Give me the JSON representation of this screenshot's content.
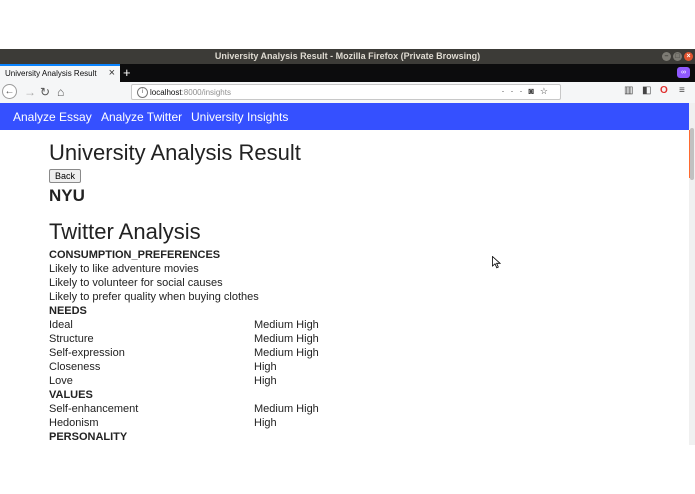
{
  "window": {
    "title": "University Analysis Result - Mozilla Firefox (Private Browsing)"
  },
  "tab": {
    "label": "University Analysis Result",
    "close": "×",
    "new_tab": "+"
  },
  "nav": {
    "url_host": "localhost",
    "url_path": ":8000/insights",
    "page_actions": "···"
  },
  "app_nav": {
    "items": [
      "Analyze Essay",
      "Analyze Twitter",
      "University Insights"
    ]
  },
  "page": {
    "heading": "University Analysis Result",
    "back_label": "Back",
    "university": "NYU",
    "section_title": "Twitter Analysis",
    "consumption_title": "CONSUMPTION_PREFERENCES",
    "consumption": [
      "Likely to like adventure movies",
      "Likely to volunteer for social causes",
      "Likely to prefer quality when buying clothes"
    ],
    "needs_title": "NEEDS",
    "needs": [
      {
        "name": "Ideal",
        "value": "Medium High"
      },
      {
        "name": "Structure",
        "value": "Medium High"
      },
      {
        "name": "Self-expression",
        "value": "Medium High"
      },
      {
        "name": "Closeness",
        "value": "High"
      },
      {
        "name": "Love",
        "value": "High"
      }
    ],
    "values_title": "VALUES",
    "values": [
      {
        "name": "Self-enhancement",
        "value": "Medium High"
      },
      {
        "name": "Hedonism",
        "value": "High"
      }
    ],
    "personality_title": "PERSONALITY"
  },
  "colors": {
    "app_nav_bg": "#3550ff",
    "titlebar_bg": "#3c3b37",
    "private_badge": "#9059ff"
  }
}
